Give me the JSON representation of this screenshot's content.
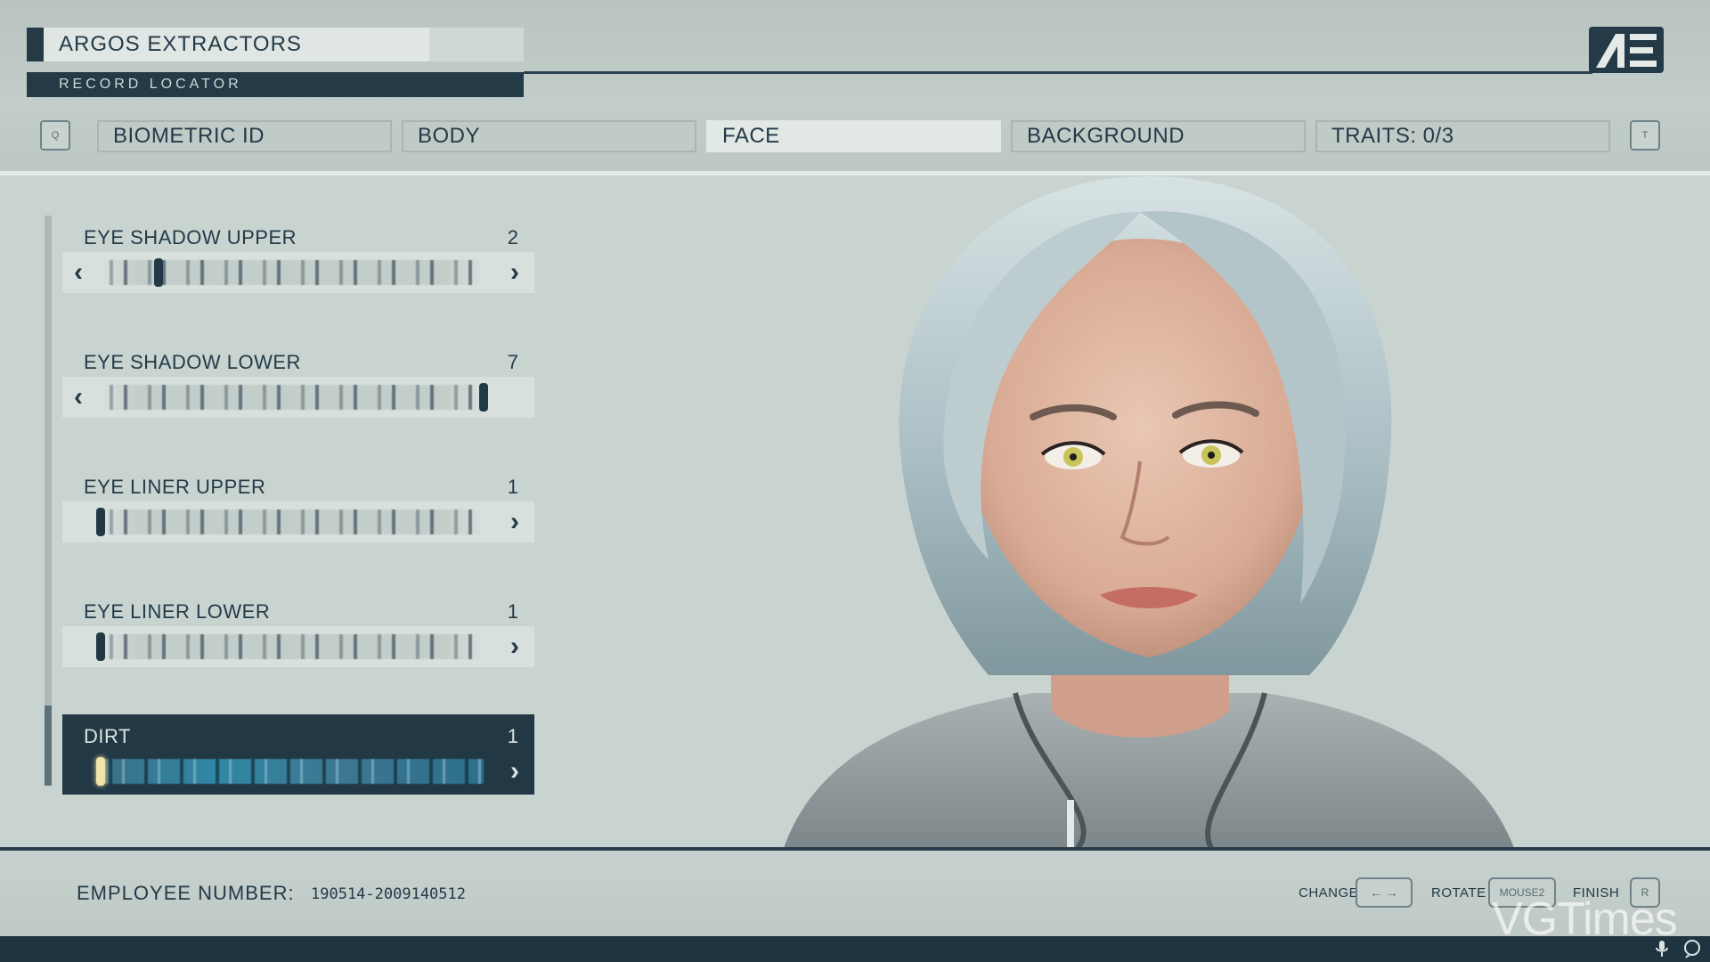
{
  "header": {
    "corp_name": "ARGOS EXTRACTORS",
    "record_locator": "RECORD LOCATOR",
    "logo": "ae-logo"
  },
  "tabs": {
    "prev_key": "Q",
    "next_key": "T",
    "items": [
      {
        "label": "BIOMETRIC ID"
      },
      {
        "label": "BODY"
      },
      {
        "label": "FACE"
      },
      {
        "label": "BACKGROUND"
      },
      {
        "label": "TRAITS: 0/3"
      }
    ],
    "active": "FACE"
  },
  "sliders": [
    {
      "label": "EYE SHADOW UPPER",
      "value": "2",
      "position": 0.15,
      "left_arrow": true
    },
    {
      "label": "EYE SHADOW LOWER",
      "value": "7",
      "position": 1.0,
      "left_arrow": true
    },
    {
      "label": "EYE LINER UPPER",
      "value": "1",
      "position": 0.0,
      "left_arrow": false
    },
    {
      "label": "EYE LINER LOWER",
      "value": "1",
      "position": 0.0,
      "left_arrow": false
    },
    {
      "label": "DIRT",
      "value": "1",
      "position": 0.0,
      "left_arrow": false,
      "selected": true
    }
  ],
  "footer": {
    "employee_label": "EMPLOYEE NUMBER:",
    "employee_number": "190514-2009140512",
    "change_label": "CHANGE",
    "change_key": "← →",
    "rotate_label": "ROTATE",
    "rotate_key": "MOUSE2",
    "finish_label": "FINISH",
    "finish_key": "R"
  },
  "watermark": "VGTimes",
  "colors": {
    "navy": "#243a47",
    "panel": "#c9d4d0",
    "selected": "#223845",
    "highlight": "#f2e3a8"
  }
}
